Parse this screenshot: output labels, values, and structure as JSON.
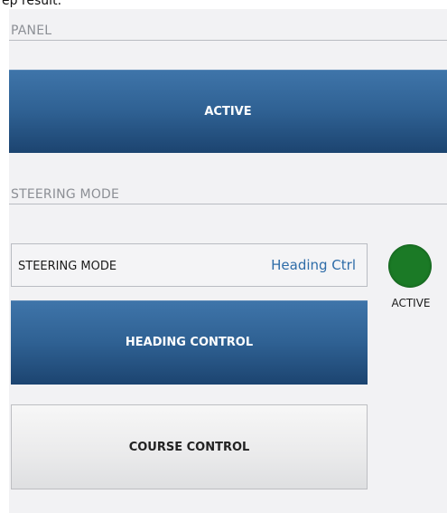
{
  "header": {
    "caption": "ep result:"
  },
  "panel_section": {
    "title": "PANEL",
    "active_button": "ACTIVE"
  },
  "steering_section": {
    "title": "STEERING MODE",
    "field": {
      "label": "STEERING MODE",
      "value": "Heading Ctrl"
    },
    "indicator": {
      "label": "ACTIVE",
      "color": "#1b7a26"
    },
    "buttons": {
      "heading": "HEADING CONTROL",
      "course": "COURSE CONTROL"
    }
  },
  "colors": {
    "accent_blue": "#2f6193",
    "value_text": "#2e6ca8",
    "panel_bg": "#f2f2f4"
  }
}
